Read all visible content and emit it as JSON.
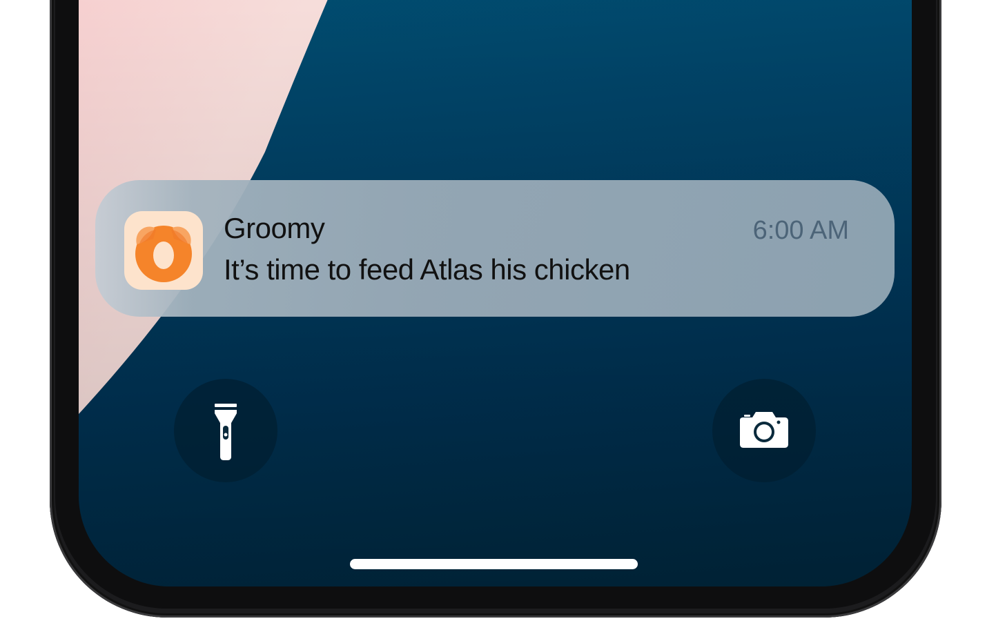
{
  "notification": {
    "app_name": "Groomy",
    "time": "6:00 AM",
    "message": "It’s time to feed Atlas his chicken",
    "app_icon": "groomy-dog-icon"
  },
  "quick_actions": {
    "left": "flashlight-icon",
    "right": "camera-icon"
  },
  "colors": {
    "wallpaper_blue": "#01456a",
    "wallpaper_pink": "#ffdede",
    "icon_orange": "#f5842a",
    "icon_background": "#fde3cc",
    "time_text": "#4c6478"
  }
}
